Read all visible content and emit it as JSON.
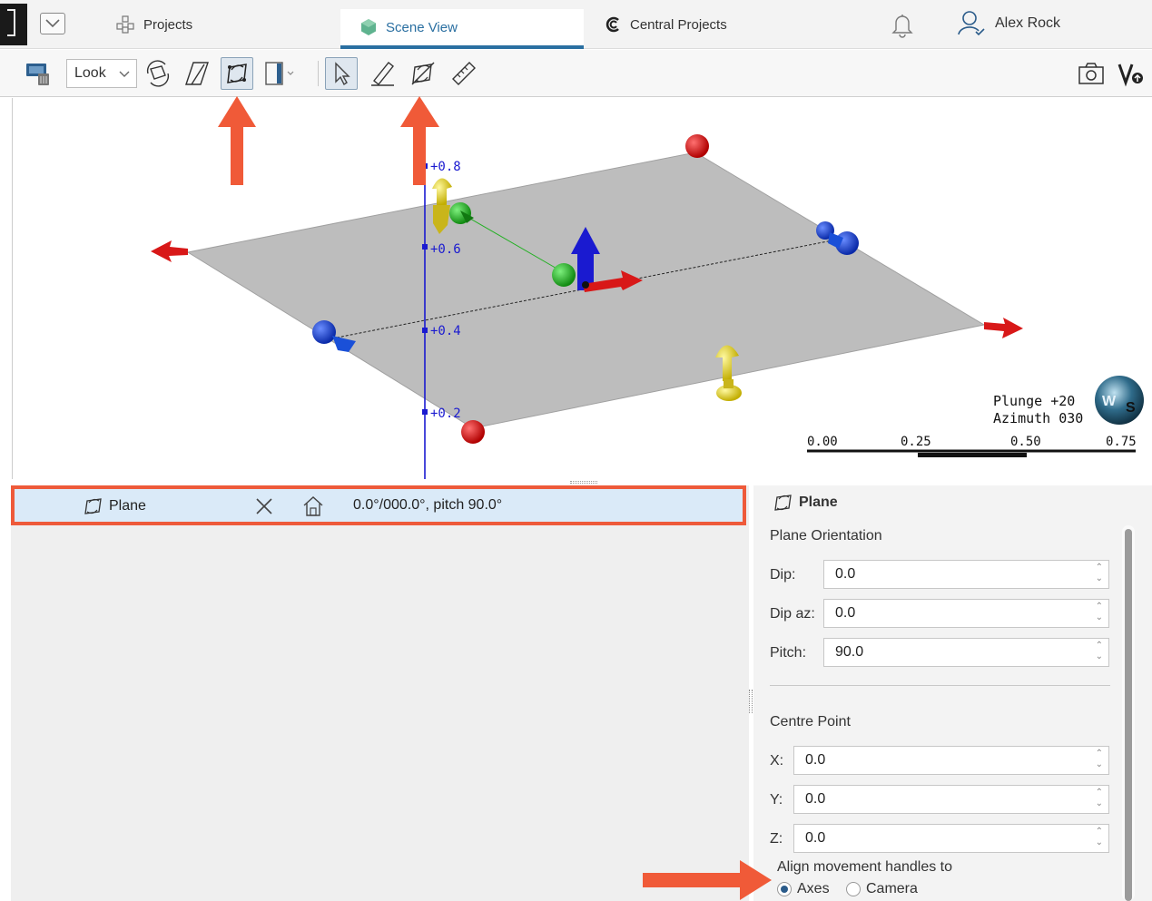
{
  "tabs": {
    "projects": "Projects",
    "scene_view": "Scene View",
    "central_projects": "Central Projects",
    "user_name": "Alex Rock"
  },
  "toolbar": {
    "look_label": "Look",
    "icons": [
      "delete-scene-icon",
      "look-dropdown",
      "rotate-view-icon",
      "draw-plane-icon",
      "new-plane-icon",
      "slice-mode-icon",
      "select-arrow-icon",
      "draw-line-icon",
      "plane-edit-icon",
      "ruler-icon",
      "screenshot-icon",
      "view-logo-icon"
    ]
  },
  "scene": {
    "elev_labels": [
      "+0.8",
      "+0.6",
      "+0.4",
      "+0.2"
    ],
    "plunge": "Plunge +20",
    "azimuth": "Azimuth 030",
    "scale_labels": [
      "0.00",
      "0.25",
      "0.50",
      "0.75"
    ],
    "compass_letters": [
      "W",
      "S"
    ],
    "colors": {
      "plane": "#bdbdbd",
      "x_handle": "#d81818",
      "y_handle": "#1a50d8",
      "z_handle": "#e8d21a",
      "centre": "#22b022",
      "elevation_axis": "#1a1ad0"
    }
  },
  "lower": {
    "row_name": "Plane",
    "row_value": "0.0°/000.0°, pitch 90.0°"
  },
  "props": {
    "title": "Plane",
    "orientation_label": "Plane Orientation",
    "dip_label": "Dip:",
    "dip_value": "0.0",
    "dipaz_label": "Dip az:",
    "dipaz_value": "0.0",
    "pitch_label": "Pitch:",
    "pitch_value": "90.0",
    "centre_label": "Centre Point",
    "x_label": "X:",
    "x_value": "0.0",
    "y_label": "Y:",
    "y_value": "0.0",
    "z_label": "Z:",
    "z_value": "0.0",
    "align_label": "Align movement handles to",
    "align_options": [
      "Axes",
      "Camera"
    ],
    "align_selected": "Axes"
  },
  "annotation_color": "#f05a38"
}
